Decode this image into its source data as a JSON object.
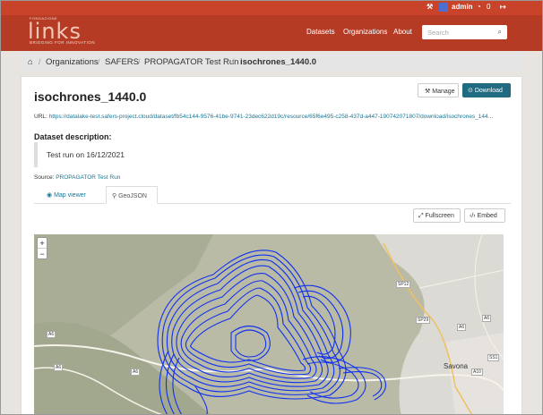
{
  "header": {
    "user": "admin",
    "notifications": "0",
    "logo_prefix": "FONDAZIONE",
    "logo_text": "links",
    "logo_tagline": "BRIDGING FOR INNOVATION",
    "nav": [
      "Datasets",
      "Organizations",
      "About"
    ],
    "search_placeholder": "Search"
  },
  "breadcrumb": [
    "Organizations",
    "SAFERS",
    "PROPAGATOR Test Run",
    "isochrones_1440.0"
  ],
  "resource": {
    "title": "isochrones_1440.0",
    "manage_label": "Manage",
    "download_label": "Download",
    "url_label": "URL:",
    "url": "https://datalake-test.safers-project.cloud/dataset/fb54c144-9576-41be-9741-23dec622d19c/resource/65f6e495-c258-437d-a447-190742071807/download/isochrones_144...",
    "desc_heading": "Dataset description:",
    "description": "Test run on 16/12/2021",
    "source_label": "Source:",
    "source_link": "PROPAGATOR Test Run"
  },
  "tabs": [
    "Map viewer",
    "GeoJSON"
  ],
  "map_toolbar": {
    "fullscreen": "Fullscreen",
    "embed": "Embed"
  },
  "map": {
    "zoom_in": "+",
    "zoom_out": "−",
    "roads": [
      "A6",
      "A6",
      "A6",
      "SP12",
      "SP29",
      "A6",
      "A6",
      "A10",
      "SS1"
    ],
    "city": "Savona"
  },
  "colors": {
    "brand": "#b63b24",
    "accent": "#206b82",
    "isochrone": "#1030f0"
  }
}
